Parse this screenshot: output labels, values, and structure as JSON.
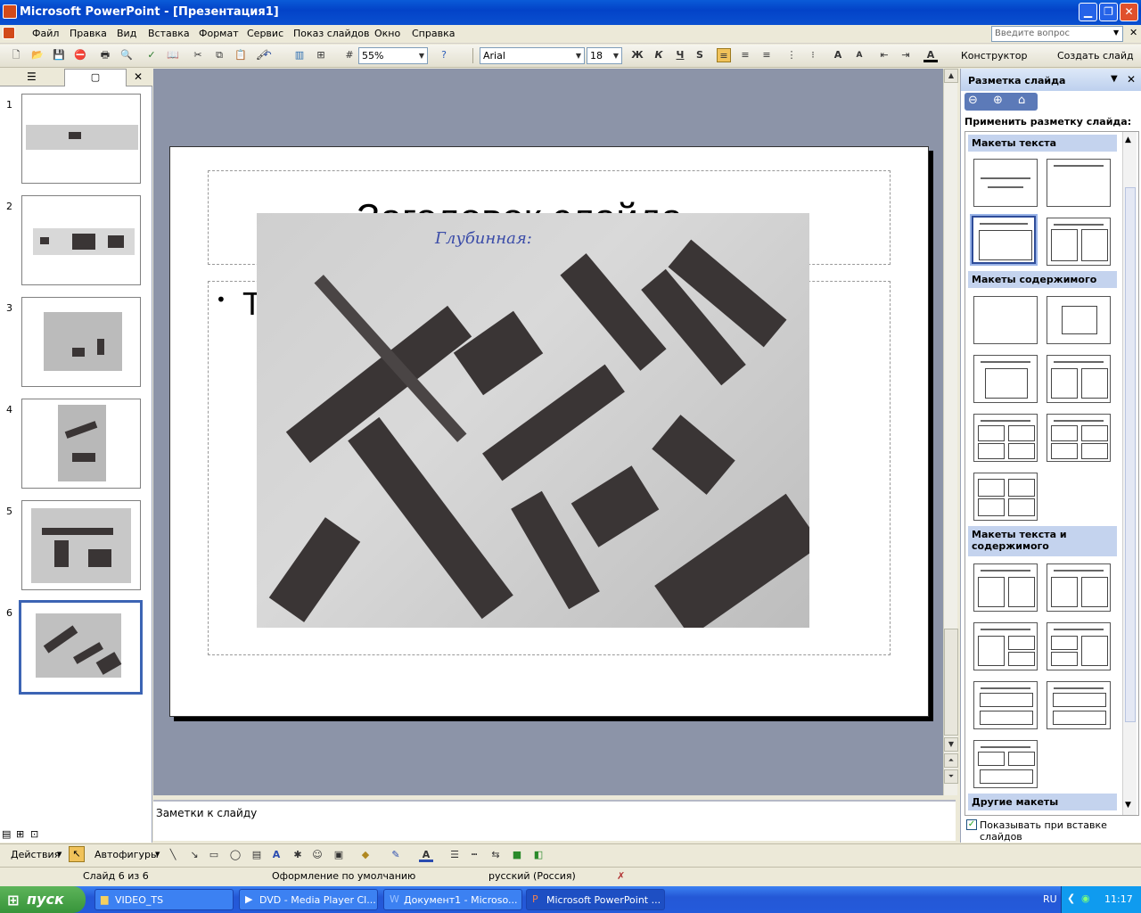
{
  "window": {
    "title": "Microsoft PowerPoint - [Презентация1]"
  },
  "menu": {
    "items": [
      "Файл",
      "Правка",
      "Вид",
      "Вставка",
      "Формат",
      "Сервис",
      "Показ слайдов",
      "Окно",
      "Справка"
    ],
    "ask_placeholder": "Введите вопрос"
  },
  "toolbar": {
    "zoom": "55%",
    "font": "Arial",
    "font_size": "18",
    "bold": "Ж",
    "italic": "К",
    "underline": "Ч",
    "shadow": "S",
    "designer": "Конструктор",
    "new_slide": "Создать слайд"
  },
  "slides_pane": {
    "numbers": [
      "1",
      "2",
      "3",
      "4",
      "5",
      "6"
    ],
    "selected": 6
  },
  "slide": {
    "title_fragment": "Заголовок слайда",
    "bullet_fragment": "Т",
    "photo_caption": "Глубинная:"
  },
  "notes": {
    "placeholder": "Заметки к слайду"
  },
  "task_pane": {
    "title": "Разметка слайда",
    "apply_label": "Применить разметку слайда:",
    "sections": [
      "Макеты текста",
      "Макеты содержимого",
      "Макеты текста и содержимого",
      "Другие макеты"
    ],
    "show_on_insert": "Показывать при вставке слайдов"
  },
  "drawing": {
    "actions": "Действия",
    "autoshapes": "Автофигуры"
  },
  "status": {
    "slide": "Слайд 6 из 6",
    "design": "Оформление по умолчанию",
    "language": "русский (Россия)"
  },
  "taskbar": {
    "start": "пуск",
    "tasks": [
      "VIDEO_TS",
      "DVD - Media Player Cl...",
      "Документ1 - Microso...",
      "Microsoft PowerPoint ..."
    ],
    "lang": "RU",
    "time": "11:17"
  }
}
